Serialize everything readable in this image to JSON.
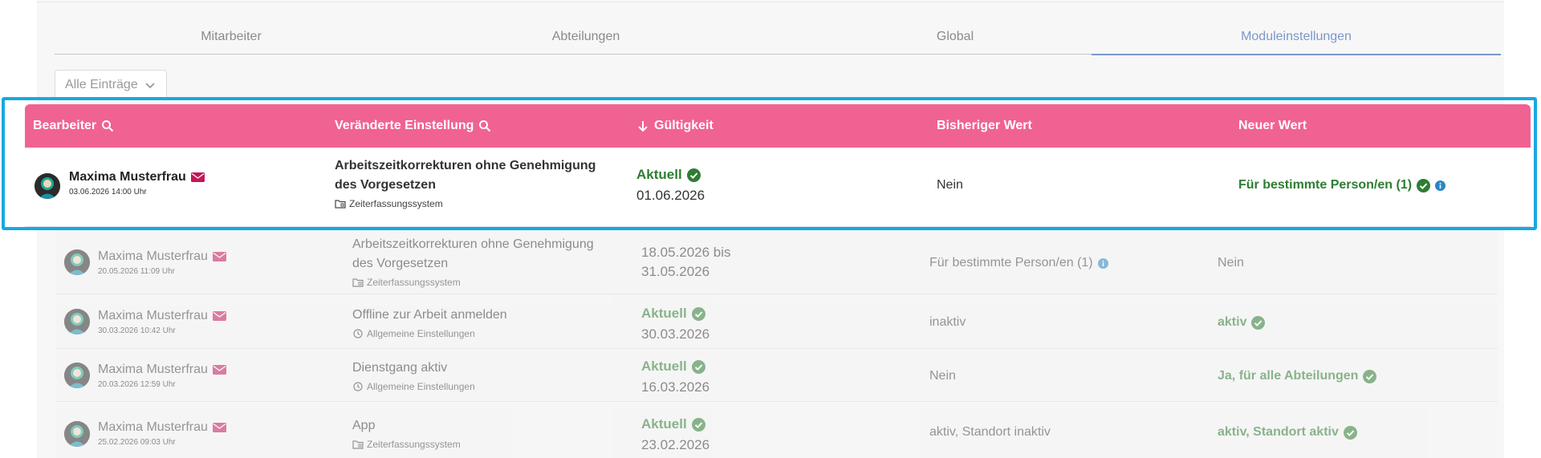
{
  "tabs": [
    {
      "label": "Mitarbeiter",
      "active": false
    },
    {
      "label": "Abteilungen",
      "active": false
    },
    {
      "label": "Global",
      "active": false
    },
    {
      "label": "Moduleinstellungen",
      "active": true
    }
  ],
  "filter": {
    "label": "Alle Einträge"
  },
  "columns": {
    "editor": "Bearbeiter",
    "setting": "Veränderte Einstellung",
    "validity": "Gültigkeit",
    "previous": "Bisheriger Wert",
    "new": "Neuer Wert"
  },
  "colors": {
    "header": "#f06292",
    "accent": "#7b97cc",
    "highlight": "#19a8e0",
    "status_green": "#2e7d32",
    "mail": "#c2185b",
    "info": "#2a86c4"
  },
  "rows": [
    {
      "user": "Maxima Musterfrau",
      "timestamp": "03.06.2026 14:00 Uhr",
      "setting_line1": "Arbeitszeitkorrekturen ohne Genehmigung",
      "setting_line2": "des Vorgesetzen",
      "module": "Zeiterfassungssystem",
      "module_icon": "folder-icon",
      "status": "Aktuell",
      "valid_from": "01.06.2026",
      "previous": "Nein",
      "new": "Für bestimmte Person/en (1)"
    },
    {
      "user": "Maxima Musterfrau",
      "timestamp": "20.05.2026 11:09 Uhr",
      "setting_line1": "Arbeitszeitkorrekturen ohne Genehmigung",
      "setting_line2": "des Vorgesetzen",
      "module": "Zeiterfassungssystem",
      "module_icon": "folder-icon",
      "valid_line1": "18.05.2026 bis",
      "valid_line2": "31.05.2026",
      "previous": "Für bestimmte Person/en (1)",
      "new": "Nein"
    },
    {
      "user": "Maxima Musterfrau",
      "timestamp": "30.03.2026 10:42 Uhr",
      "setting_line1": "Offline zur Arbeit anmelden",
      "module": "Allgemeine Einstellungen",
      "module_icon": "clock-icon",
      "status": "Aktuell",
      "valid_from": "30.03.2026",
      "previous": "inaktiv",
      "new": "aktiv"
    },
    {
      "user": "Maxima Musterfrau",
      "timestamp": "20.03.2026 12:59 Uhr",
      "setting_line1": "Dienstgang aktiv",
      "module": "Allgemeine Einstellungen",
      "module_icon": "clock-icon",
      "status": "Aktuell",
      "valid_from": "16.03.2026",
      "previous": "Nein",
      "new": "Ja, für alle Abteilungen"
    },
    {
      "user": "Maxima Musterfrau",
      "timestamp": "25.02.2026 09:03 Uhr",
      "setting_line1": "App",
      "module": "Zeiterfassungssystem",
      "module_icon": "folder-icon",
      "status": "Aktuell",
      "valid_from": "23.02.2026",
      "previous": "aktiv, Standort inaktiv",
      "new": "aktiv, Standort aktiv"
    }
  ]
}
